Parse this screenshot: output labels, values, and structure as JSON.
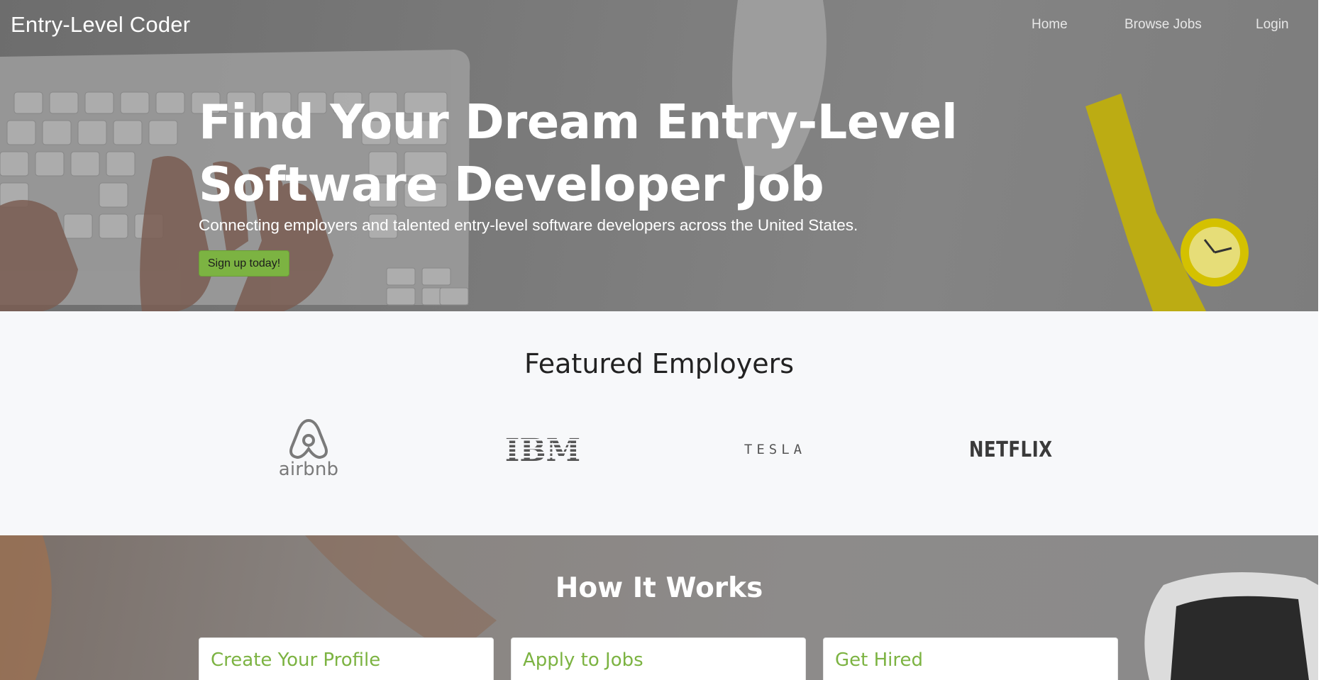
{
  "header": {
    "brand": "Entry-Level Coder",
    "nav": [
      "Home",
      "Browse Jobs",
      "Login"
    ]
  },
  "hero": {
    "title": "Find Your Dream Entry-Level Software Developer Job",
    "subtitle": "Connecting employers and talented entry-level software developers across the United States.",
    "cta_label": "Sign up today!"
  },
  "featured": {
    "title": "Featured Employers",
    "employers": [
      "airbnb",
      "IBM",
      "TESLA",
      "NETFLIX"
    ]
  },
  "how_it_works": {
    "title": "How It Works",
    "cards": [
      "Create Your Profile",
      "Apply to Jobs",
      "Get Hired"
    ]
  },
  "colors": {
    "accent": "#7cb342",
    "hero_overlay": "#777777",
    "section_bg": "#f7f8fa"
  }
}
